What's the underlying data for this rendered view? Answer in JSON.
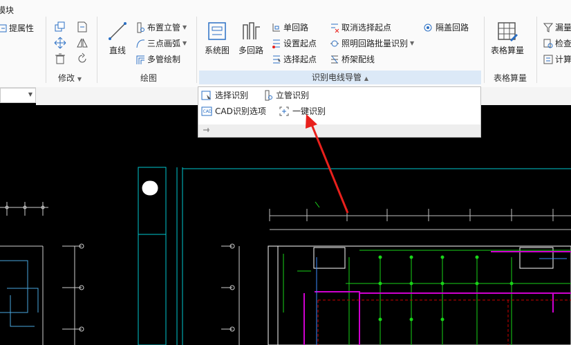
{
  "ribbon": {
    "module_tab": "模块",
    "prop_button": "提属性",
    "modify_label": "修改",
    "draw": {
      "line": "直线",
      "riser": "布置立管",
      "arc": "三点画弧",
      "multi_pipe": "多管绘制",
      "group_label": "绘图"
    },
    "detect": {
      "system_diagram": "系统图",
      "multi_circuit": "多回路",
      "single_circuit": "单回路",
      "set_start": "设置起点",
      "select_start": "选择起点",
      "cancel_start": "取消选择起点",
      "lighting_batch": "照明回路批量识别",
      "tray_wiring": "桥架配线",
      "hidden_circuit": "隔盖回路",
      "group_label": "识别电线导管"
    },
    "table": {
      "table_calc": "表格算量",
      "group_label": "表格算量"
    },
    "right": {
      "missing": "漏量",
      "check": "检查",
      "calc": "计算"
    }
  },
  "dropdown": {
    "select_detect": "选择识别",
    "riser_detect": "立管识别",
    "cad_options": "CAD识别选项",
    "one_click": "一键识别"
  },
  "colors": {
    "arrow": "#e8201c",
    "cad_cyan": "#00c8d0",
    "cad_green": "#19d419",
    "cad_magenta": "#d000d0",
    "cad_red": "#cc0000",
    "accent_blue": "#2a6fc4"
  }
}
